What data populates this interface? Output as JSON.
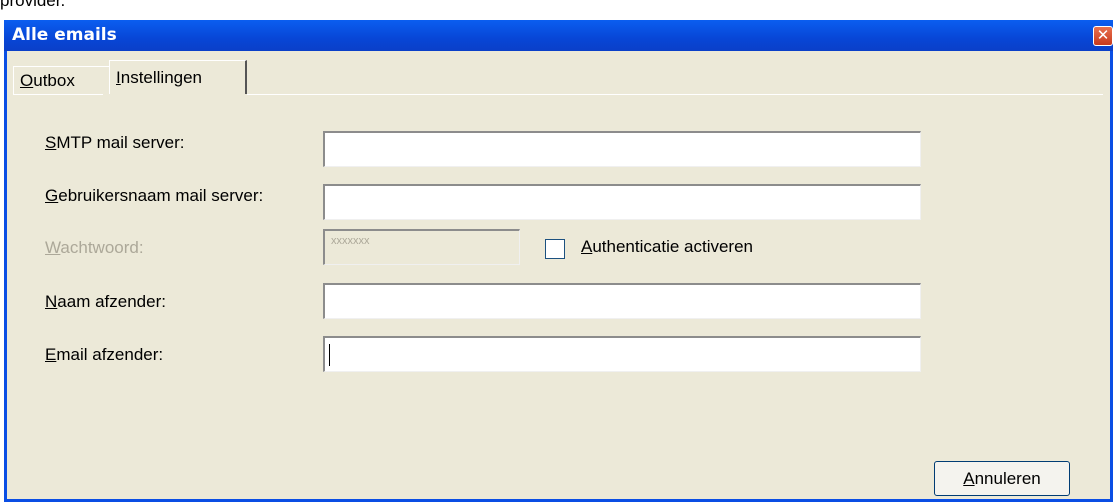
{
  "top_text": "provider.",
  "window": {
    "title": "Alle emails",
    "close_glyph": "✕"
  },
  "tabs": [
    {
      "label_first": "O",
      "label_rest": "utbox",
      "active": false
    },
    {
      "label_first": "I",
      "label_rest": "nstellingen",
      "active": true
    }
  ],
  "form": {
    "smtp_server": {
      "label_first": "S",
      "label_rest": "MTP mail server:",
      "value": ""
    },
    "username": {
      "label_first": "G",
      "label_rest": "ebruikersnaam mail server:",
      "value": ""
    },
    "password": {
      "label_first": "W",
      "label_rest": "achtwoord:",
      "value": "xxxxxxx",
      "enabled": false
    },
    "auth_checkbox": {
      "label_first": "A",
      "label_rest": "uthenticatie activeren",
      "checked": false
    },
    "sender_name": {
      "label_first": "N",
      "label_rest": "aam afzender:",
      "value": ""
    },
    "sender_email": {
      "label_first": "E",
      "label_rest": "mail afzender:",
      "value": ""
    }
  },
  "buttons": {
    "cancel": {
      "label_first": "A",
      "label_rest": "nnuleren"
    }
  },
  "colors": {
    "titlebar": "#0a4ee4",
    "dialog_bg": "#ece9d8",
    "disabled_text": "#aca899"
  }
}
